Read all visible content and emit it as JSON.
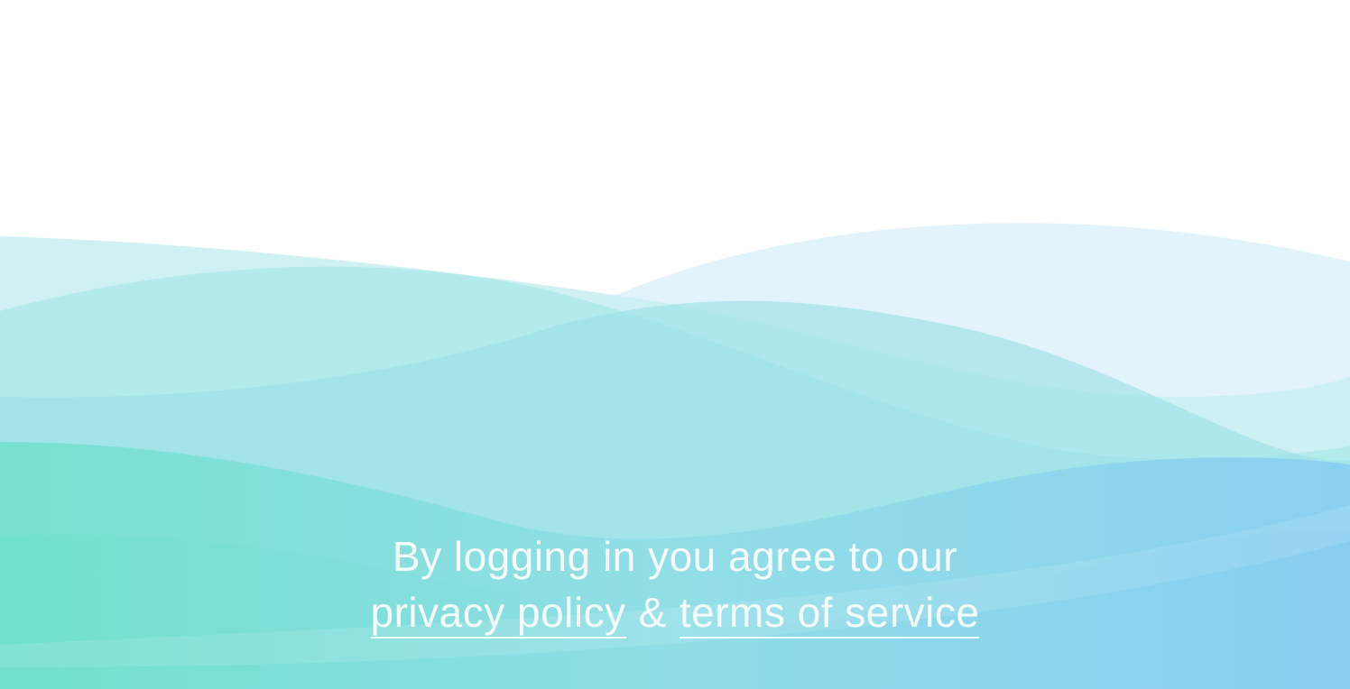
{
  "background": {
    "name": "wave-background",
    "colors": {
      "page": "#ffffff",
      "teal": "#6fe0cc",
      "aqua": "#8fdfe4",
      "sky": "#86cdf2",
      "pale": "#dff1fb"
    }
  },
  "legal": {
    "line1": "By logging in you agree to our",
    "privacy_link": "privacy policy",
    "ampersand": "&",
    "terms_link": "terms of service"
  }
}
